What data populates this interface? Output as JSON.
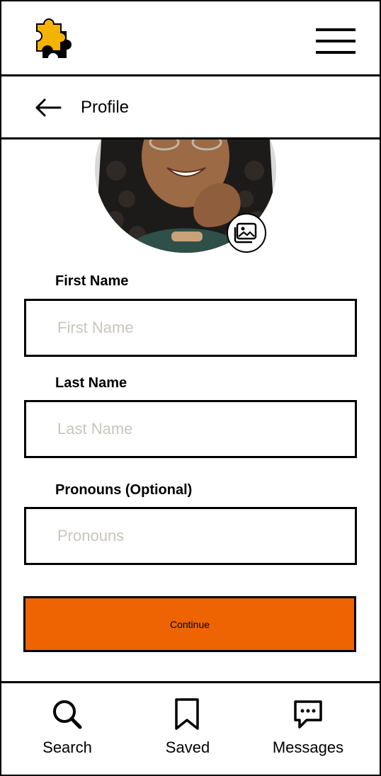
{
  "header": {
    "logo_icon": "puzzle-piece-icon",
    "menu_icon": "hamburger-menu-icon"
  },
  "subheader": {
    "back_icon": "arrow-left-icon",
    "title": "Profile"
  },
  "avatar": {
    "edit_photo_icon": "image-gallery-icon"
  },
  "form": {
    "first_name": {
      "label": "First Name",
      "placeholder": "First Name",
      "value": ""
    },
    "last_name": {
      "label": "Last Name",
      "placeholder": "Last Name",
      "value": ""
    },
    "pronouns": {
      "label": "Pronouns (Optional)",
      "placeholder": "Pronouns",
      "value": ""
    },
    "continue_label": "Continue"
  },
  "bottom_nav": {
    "items": [
      {
        "label": "Search",
        "icon": "search-icon"
      },
      {
        "label": "Saved",
        "icon": "bookmark-icon"
      },
      {
        "label": "Messages",
        "icon": "chat-bubble-icon"
      }
    ]
  },
  "colors": {
    "accent": "#ef6402",
    "logo_yellow": "#f5b301",
    "border": "#000000",
    "placeholder": "#c9c5bd"
  }
}
